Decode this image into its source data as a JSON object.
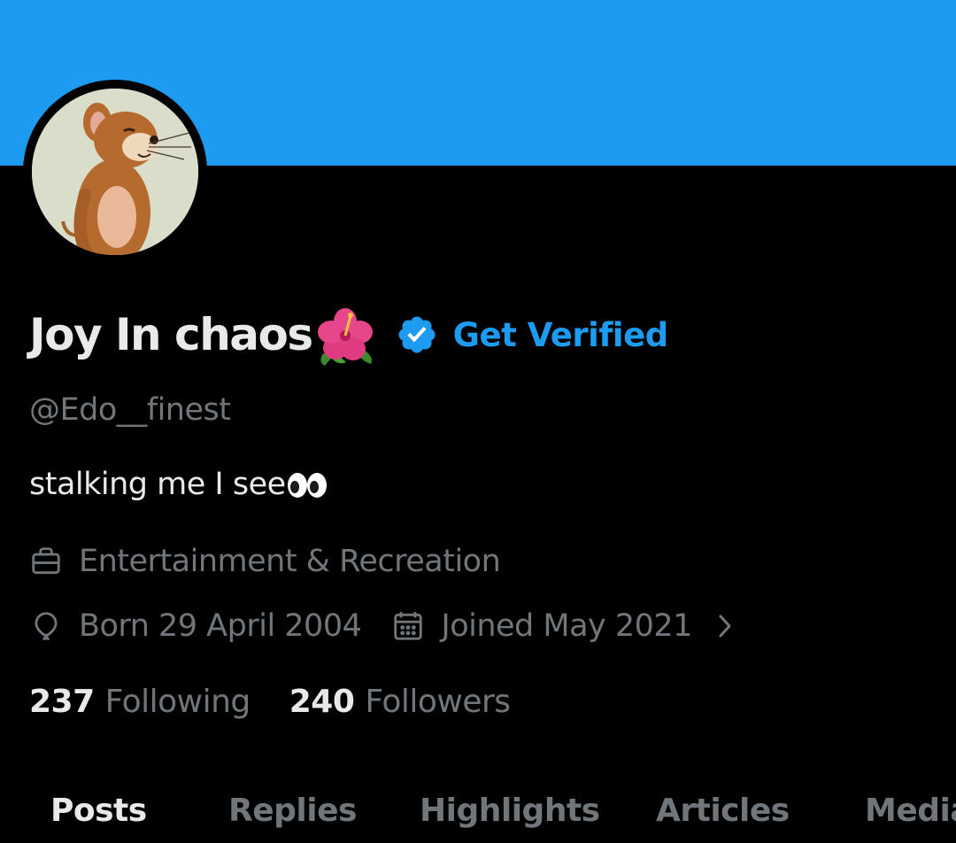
{
  "profile": {
    "display_name": "Joy In chaos",
    "name_emoji": "hibiscus-icon",
    "get_verified_label": "Get Verified",
    "handle": "@Edo__finest",
    "bio": "stalking me I see",
    "bio_emoji": "eyes-icon",
    "category": "Entertainment & Recreation",
    "born": "Born 29 April 2004",
    "joined": "Joined May 2021",
    "following_count": "237",
    "following_label": "Following",
    "followers_count": "240",
    "followers_label": "Followers"
  },
  "tabs": [
    {
      "label": "Posts",
      "active": true
    },
    {
      "label": "Replies",
      "active": false
    },
    {
      "label": "Highlights",
      "active": false
    },
    {
      "label": "Articles",
      "active": false
    },
    {
      "label": "Media",
      "active": false
    }
  ],
  "colors": {
    "banner": "#1d9bf0",
    "accent": "#1d9bf0",
    "background": "#000000",
    "primary_text": "#e7e9ea",
    "secondary_text": "#71767b"
  }
}
